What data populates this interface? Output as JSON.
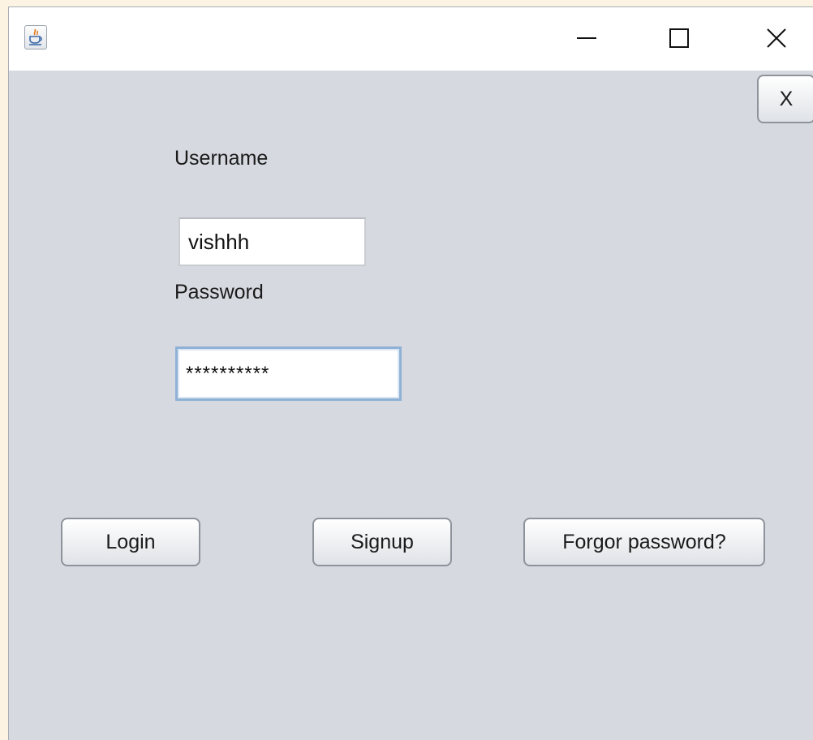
{
  "window": {
    "controls": {
      "minimize_icon": "minimize-icon",
      "maximize_icon": "maximize-icon",
      "close_icon": "close-icon"
    },
    "app_icon": "java-icon"
  },
  "form": {
    "close_button_label": "X",
    "username_label": "Username",
    "username_value": "vishhh",
    "password_label": "Password",
    "password_value": "**********"
  },
  "actions": {
    "login_label": "Login",
    "signup_label": "Signup",
    "forgot_label": "Forgor password?"
  }
}
